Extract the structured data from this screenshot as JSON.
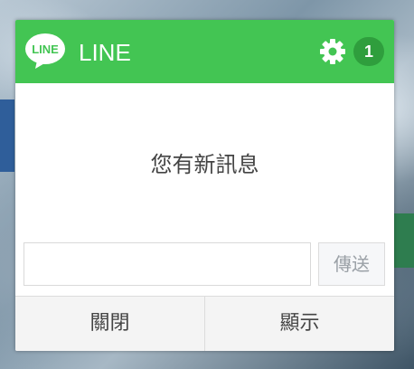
{
  "app": {
    "title": "LINE",
    "logo_text": "LINE",
    "notification_count": "1"
  },
  "icons": {
    "logo": "line-logo-icon",
    "settings": "gear-icon"
  },
  "colors": {
    "brand_green": "#43c553",
    "badge_green": "#2f9e3d"
  },
  "notification": {
    "message": "您有新訊息"
  },
  "reply": {
    "input_value": "",
    "send_label": "傳送"
  },
  "actions": {
    "close_label": "關閉",
    "show_label": "顯示"
  }
}
